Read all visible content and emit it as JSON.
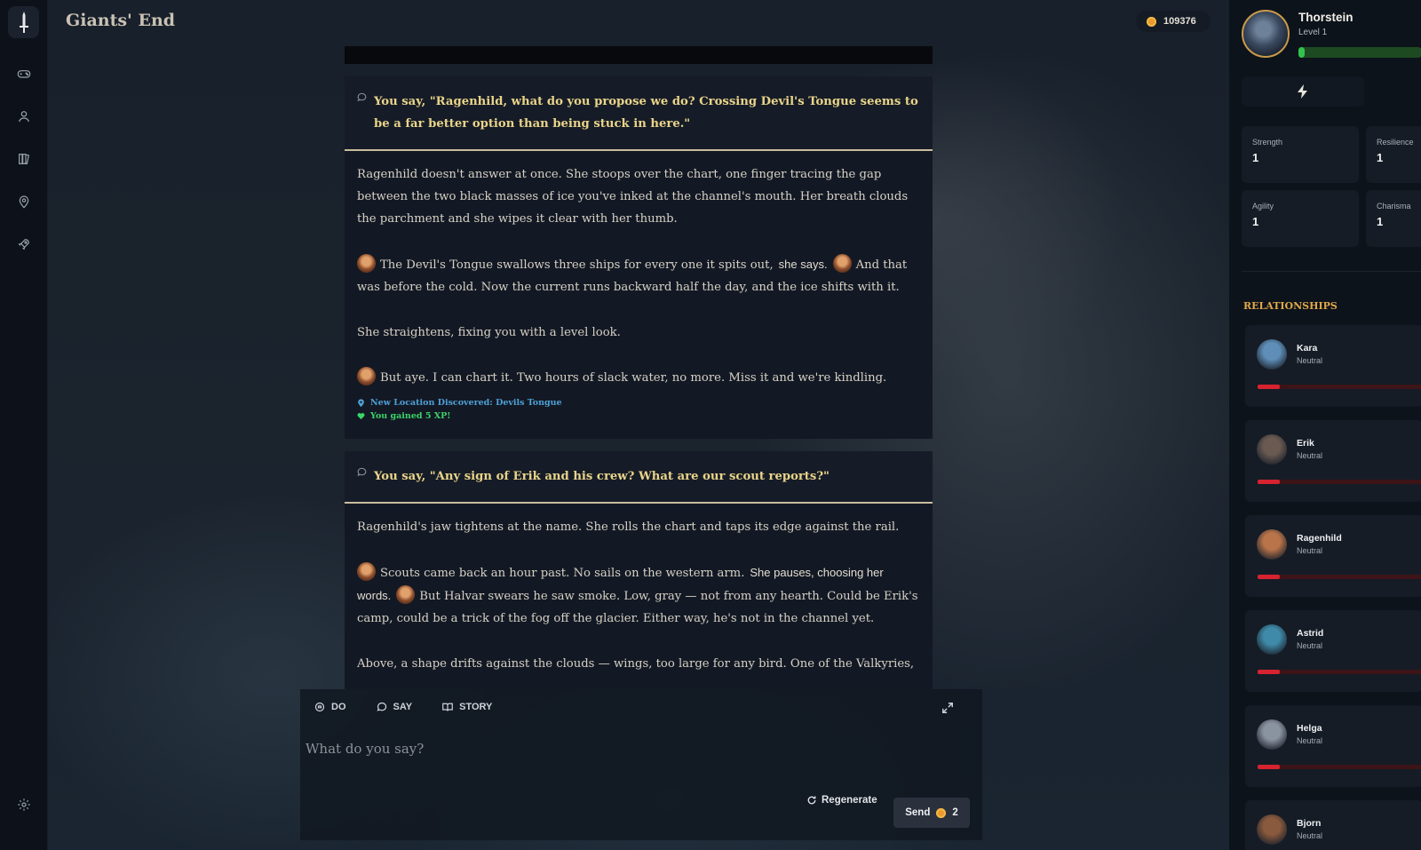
{
  "app": {
    "title": "Giants' End"
  },
  "currency": {
    "amount": "109376"
  },
  "player": {
    "name": "Thorstein",
    "level": "Level 1",
    "xp_fraction": 0.05
  },
  "stats": [
    {
      "label": "Strength",
      "value": "1"
    },
    {
      "label": "Resilience",
      "value": "1"
    },
    {
      "label": "Agility",
      "value": "1"
    },
    {
      "label": "Charisma",
      "value": "1"
    }
  ],
  "relationships": {
    "title": "RELATIONSHIPS",
    "items": [
      {
        "name": "Kara",
        "status": "Neutral",
        "level": 0.13,
        "avatar_color": "#5f8fb8"
      },
      {
        "name": "Erik",
        "status": "Neutral",
        "level": 0.13,
        "avatar_color": "#6a5a52"
      },
      {
        "name": "Ragenhild",
        "status": "Neutral",
        "level": 0.13,
        "avatar_color": "#b9744a"
      },
      {
        "name": "Astrid",
        "status": "Neutral",
        "level": 0.13,
        "avatar_color": "#3f8aa8"
      },
      {
        "name": "Helga",
        "status": "Neutral",
        "level": 0.13,
        "avatar_color": "#8a94a0"
      },
      {
        "name": "Bjorn",
        "status": "Neutral",
        "level": 0.13,
        "avatar_color": "#8a5a3e"
      }
    ]
  },
  "story": {
    "say1": "You say, \"Ragenhild, what do you propose we do? Crossing Devil's Tongue seems to be a far better option than being stuck in here.\"",
    "narr1": {
      "p1": "Ragenhild doesn't answer at once. She stoops over the chart, one finger tracing the gap between the two black masses of ice you've inked at the channel's mouth. Her breath clouds the parchment and she wipes it clear with her thumb.",
      "p2a": "The Devil's Tongue swallows three ships for every one it spits out,",
      "p2b": "she says.",
      "p2c": "And that was before the cold. Now the current runs backward half the day, and the ice shifts with it.",
      "p3": "She straightens, fixing you with a level look.",
      "p4": "But aye. I can chart it. Two hours of slack water, no more. Miss it and we're kindling.",
      "notice_location": "New Location Discovered: Devils Tongue",
      "notice_xp": "You gained 5 XP!"
    },
    "say2": "You say, \"Any sign of Erik and his crew? What are our scout reports?\"",
    "narr2": {
      "p1": "Ragenhild's jaw tightens at the name. She rolls the chart and taps its edge against the rail.",
      "p2a": "Scouts came back an hour past. No sails on the western arm.",
      "p2b": "She pauses, choosing her words.",
      "p2c": "But Halvar swears he saw smoke. Low, gray — not from any hearth. Could be Erik's camp, could be a trick of the fog off the glacier. Either way, he's not in the channel yet.",
      "p3": "Above, a shape drifts against the clouds — wings, too large for any bird. One of the Valkyries,"
    }
  },
  "input": {
    "tabs": {
      "do": "DO",
      "say": "SAY",
      "story": "STORY"
    },
    "placeholder": "What do you say?",
    "regenerate": "Regenerate",
    "send": "Send",
    "send_cost": "2"
  },
  "icons": {
    "rail": [
      "sword-icon",
      "gamepad-icon",
      "user-icon",
      "book-icon",
      "map-pin-icon",
      "rocket-icon",
      "settings-icon"
    ]
  }
}
